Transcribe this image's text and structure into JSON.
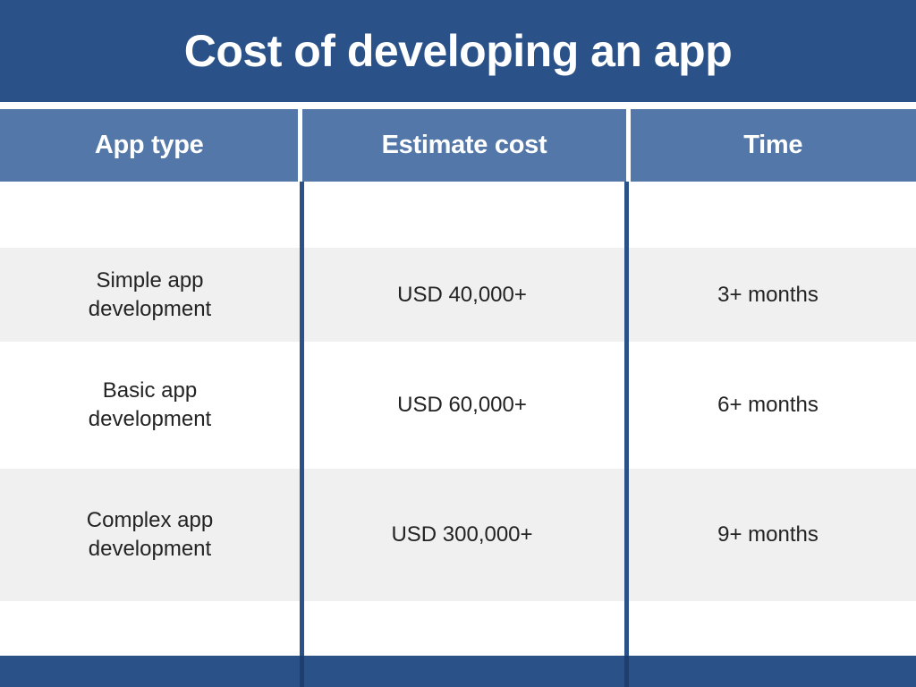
{
  "title": "Cost of developing an app",
  "colors": {
    "title_band": "#2B5189",
    "header_row": "#5277A8",
    "divider": "#2B5189",
    "row_shaded": "#F0F0F0",
    "row_plain": "#FFFFFF",
    "text": "#232323",
    "header_text": "#FFFFFF"
  },
  "table": {
    "headers": {
      "app_type": "App type",
      "estimate_cost": "Estimate cost",
      "time": "Time"
    },
    "rows": [
      {
        "app_type_line1": "Simple app",
        "app_type_line2": "development",
        "estimate_cost": "USD 40,000+",
        "time": "3+ months"
      },
      {
        "app_type_line1": "Basic app",
        "app_type_line2": "development",
        "estimate_cost": "USD 60,000+",
        "time": "6+ months"
      },
      {
        "app_type_line1": "Complex app",
        "app_type_line2": "development",
        "estimate_cost": "USD 300,000+",
        "time": "9+ months"
      }
    ]
  }
}
